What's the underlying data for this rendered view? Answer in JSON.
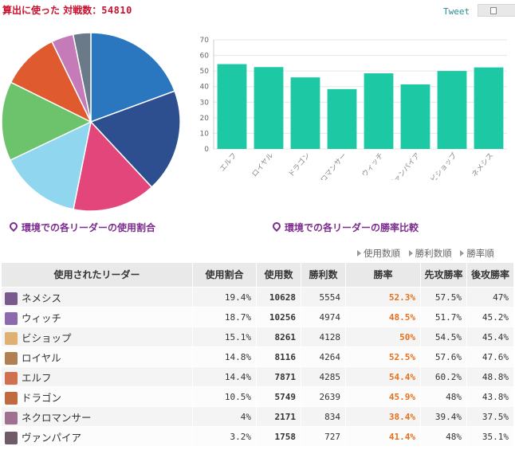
{
  "header": {
    "title_prefix": "算出に使った",
    "title_label": "対戦数：",
    "match_count": "54810",
    "tweet_label": "Tweet"
  },
  "captions": {
    "pie": "環境での各リーダーの使用割合",
    "bar": "環境での各リーダーの勝率比較"
  },
  "sort_links": [
    "使用数順",
    "勝利数順",
    "勝率順"
  ],
  "table": {
    "headers": [
      "使用されたリーダー",
      "使用割合",
      "使用数",
      "勝利数",
      "勝率",
      "先攻勝率",
      "後攻勝率"
    ],
    "rows": [
      {
        "leader": "ネメシス",
        "share": "19.4%",
        "used": "10628",
        "wins": "5554",
        "winrate": "52.3%",
        "first": "57.5%",
        "second": "47%",
        "avatar": "#7a5a8c"
      },
      {
        "leader": "ウィッチ",
        "share": "18.7%",
        "used": "10256",
        "wins": "4974",
        "winrate": "48.5%",
        "first": "51.7%",
        "second": "45.2%",
        "avatar": "#8c6ab0"
      },
      {
        "leader": "ビショップ",
        "share": "15.1%",
        "used": "8261",
        "wins": "4128",
        "winrate": "50%",
        "first": "54.5%",
        "second": "45.4%",
        "avatar": "#e0b070"
      },
      {
        "leader": "ロイヤル",
        "share": "14.8%",
        "used": "8116",
        "wins": "4264",
        "winrate": "52.5%",
        "first": "57.6%",
        "second": "47.6%",
        "avatar": "#b08050"
      },
      {
        "leader": "エルフ",
        "share": "14.4%",
        "used": "7871",
        "wins": "4285",
        "winrate": "54.4%",
        "first": "60.2%",
        "second": "48.8%",
        "avatar": "#d07050"
      },
      {
        "leader": "ドラゴン",
        "share": "10.5%",
        "used": "5749",
        "wins": "2639",
        "winrate": "45.9%",
        "first": "48%",
        "second": "43.8%",
        "avatar": "#c06a40"
      },
      {
        "leader": "ネクロマンサー",
        "share": "4%",
        "used": "2171",
        "wins": "834",
        "winrate": "38.4%",
        "first": "39.4%",
        "second": "37.5%",
        "avatar": "#a07090"
      },
      {
        "leader": "ヴァンパイア",
        "share": "3.2%",
        "used": "1758",
        "wins": "727",
        "winrate": "41.4%",
        "first": "48%",
        "second": "35.1%",
        "avatar": "#705a6a"
      }
    ]
  },
  "chart_data": [
    {
      "type": "pie",
      "categories": [
        "ネメシス",
        "ウィッチ",
        "ビショップ",
        "ロイヤル",
        "エルフ",
        "ドラゴン",
        "ネクロマンサー",
        "ヴァンパイア"
      ],
      "values": [
        19.4,
        18.7,
        15.1,
        14.8,
        14.4,
        10.5,
        4,
        3.2
      ],
      "colors": [
        "#2a77c0",
        "#2d4f8f",
        "#e3467a",
        "#8fd6ee",
        "#6cc36c",
        "#e05a30",
        "#c47bb7",
        "#6a7a88"
      ],
      "title": ""
    },
    {
      "type": "bar",
      "categories": [
        "エルフ",
        "ロイヤル",
        "ドラゴン",
        "ネクロマンサー",
        "ウィッチ",
        "ヴァンパイア",
        "ビショップ",
        "ネメシス"
      ],
      "values": [
        54.4,
        52.5,
        45.9,
        38.4,
        48.5,
        41.4,
        50,
        52.3
      ],
      "color": "#1cc9a4",
      "ylim": [
        0,
        70
      ],
      "yticks": [
        0,
        10,
        20,
        30,
        40,
        50,
        60,
        70
      ],
      "grid": true,
      "title": "",
      "xlabel": "",
      "ylabel": ""
    }
  ]
}
